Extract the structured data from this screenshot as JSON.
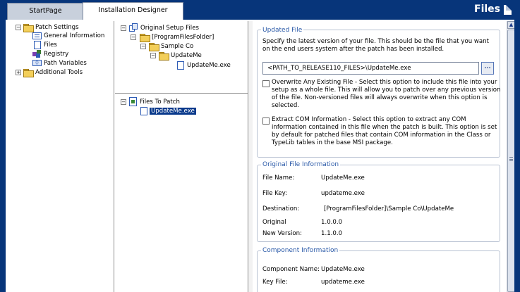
{
  "tabs": [
    {
      "label": "StartPage",
      "active": false
    },
    {
      "label": "Installation Designer",
      "active": true
    }
  ],
  "header": {
    "title": "Files",
    "icon": "document-icon"
  },
  "nav": {
    "patch_settings": "Patch Settings",
    "items": [
      {
        "label": "General Information",
        "icon": "form-icon"
      },
      {
        "label": "Files",
        "icon": "document-icon"
      },
      {
        "label": "Registry",
        "icon": "registry-icon"
      },
      {
        "label": "Path Variables",
        "icon": "variables-icon"
      }
    ],
    "additional_tools": "Additional Tools"
  },
  "setup_tree": {
    "root": "Original Setup Files",
    "folder1": "[ProgramFilesFolder]",
    "folder2": "Sample Co",
    "folder3": "UpdateMe",
    "file": "UpdateMe.exe"
  },
  "patch_tree": {
    "root": "Files To Patch",
    "file": "UpdateMe.exe"
  },
  "updated_file": {
    "section_title": "Updated File",
    "description_line1": "Specify the latest version of your file.  This should be the file that you want",
    "description_line2": "on the end users system after the patch has been installed.",
    "path_value": "<PATH_TO_RELEASE110_FILES>\\UpdateMe.exe",
    "browse_label": "...",
    "overwrite_line1": "Overwrite Any Existing File - Select this option to include this file into your",
    "overwrite_line2": "setup as a whole file. This will allow you to patch over any previous version",
    "overwrite_line3": "of the file.  Non-versioned files will always overwrite when this option is",
    "overwrite_line4": "selected.",
    "com_line1": "Extract COM Information - Select this option to extract any COM",
    "com_line2": "information contained in this file when the patch is built. This option is set",
    "com_line3": "by default for patched files that contain COM information in the Class or",
    "com_line4": "TypeLib tables in the base MSI package."
  },
  "original_info": {
    "section_title": "Original File Information",
    "fields": [
      {
        "label": "File Name:",
        "value": "UpdateMe.exe"
      },
      {
        "label": "File Key:",
        "value": "updateme.exe"
      },
      {
        "label": "Destination:",
        "value": "[ProgramFilesFolder]\\Sample Co\\UpdateMe"
      },
      {
        "label": "Original",
        "value": "1.0.0.0"
      },
      {
        "label": "New Version:",
        "value": "1.1.0.0"
      }
    ]
  },
  "component_info": {
    "section_title": "Component Information",
    "fields": [
      {
        "label": "Component Name:",
        "value": "UpdateMe.exe"
      },
      {
        "label": "Key File:",
        "value": "updateme.exe"
      }
    ]
  },
  "colors": {
    "accent": "#07357a",
    "section_title": "#2b5aa8",
    "selection": "#0a3a8c"
  }
}
